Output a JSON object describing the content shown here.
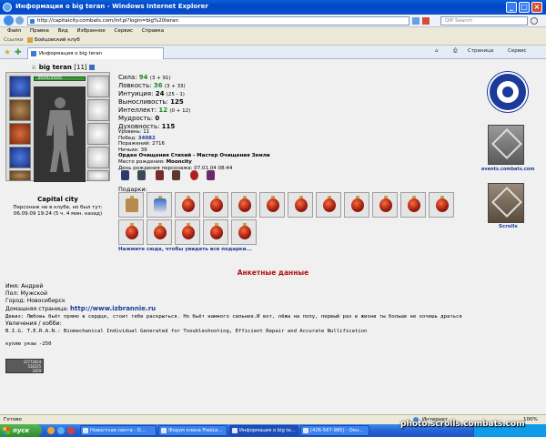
{
  "window": {
    "title": "Информация о big teran - Windows Internet Explorer"
  },
  "addressbar": {
    "url": "http://capitalcity.combats.com/inf.pl?login=big%20teran",
    "search_placeholder": "QIP Search"
  },
  "menu": [
    "Файл",
    "Правка",
    "Вид",
    "Избранное",
    "Сервис",
    "Справка"
  ],
  "links": {
    "label": "Ссылки",
    "item": "Бойцовский клуб"
  },
  "tabs": {
    "active_tab": "Информация о big teran",
    "page_btn": "Страница",
    "service_btn": "Сервис"
  },
  "character": {
    "name": "big teran",
    "level": "[11]",
    "hp": "3505/3505",
    "city": "Capital city",
    "status_line1": "Персонаж не в клубе, но был тут:",
    "status_line2": "06.09.09 19:24 (5 ч. 4 мин. назад)"
  },
  "stats": [
    {
      "label": "Сила:",
      "value": "94",
      "extra": "(3 + 91)"
    },
    {
      "label": "Ловкость:",
      "value": "36",
      "extra": "(3 + 33)"
    },
    {
      "label": "Интуиция:",
      "value": "24",
      "extra": "(25 - 1)"
    },
    {
      "label": "Выносливость:",
      "value": "125",
      "extra": ""
    },
    {
      "label": "Интеллект:",
      "value": "12",
      "extra": "(0 + 12)"
    },
    {
      "label": "Мудрость:",
      "value": "0",
      "extra": ""
    },
    {
      "label": "Духовность:",
      "value": "115",
      "extra": ""
    }
  ],
  "info": {
    "level": "Уровень: 11",
    "wins_label": "Побед:",
    "wins": "34082",
    "losses": "Поражений: 2716",
    "draws": "Ничьих: 39",
    "order": "Орден Очищения Стихий - Мастер Очищения Земли",
    "birthplace_label": "Место рождения:",
    "birthplace": "Mooncity",
    "birthday": "День рождения персонажа: 07.01.04 08:44"
  },
  "gifts": {
    "label": "Подарки:",
    "more_link": "Нажмите сюда, чтобы увидеть все подарки..."
  },
  "side": {
    "events_label": "events.combats.com",
    "scrolls_label": "Scrolls"
  },
  "profile": {
    "heading": "Анкетные данные",
    "name": "Имя: Андрей",
    "sex": "Пол: Мужской",
    "city": "Город: Новосибирск",
    "homepage_label": "Домашняя страница:",
    "homepage": "http://www.izbrannie.ru",
    "motto": "Девиз: Любовь бьёт прямо в сердце, стоит тебе раскрыться. Но бьёт намного сильнее.И вот, лёжа на полу, первый раз в жизни ты больше не хочешь драться",
    "hobby_label": "Увлечения / хобби:",
    "hobby": "B.I.G. T.E.R.A.N.: Biomechanical Individual Generated for Tooubleshooting, Efficient Repair and Accurate Nullification",
    "buy": "куплю уязы -250"
  },
  "counter": {
    "line1": "12772624",
    "line2": "526155",
    "line3": "3359"
  },
  "statusbar": {
    "left": "Готово",
    "zone": "Интернет",
    "zoom": "100%"
  },
  "taskbar": {
    "start": "пуск",
    "tasks": [
      "Новостная лента - D...",
      "Форум клана FreeLe...",
      "Информация о big te...",
      "[426-567-985] - Окн..."
    ]
  },
  "watermark": "photo.scrolls.combats.com",
  "colors": {
    "accent": "#0a5fd8",
    "win_green": "#1a8a1a",
    "heading_red": "#b01010",
    "link_blue": "#1a3a9a"
  }
}
